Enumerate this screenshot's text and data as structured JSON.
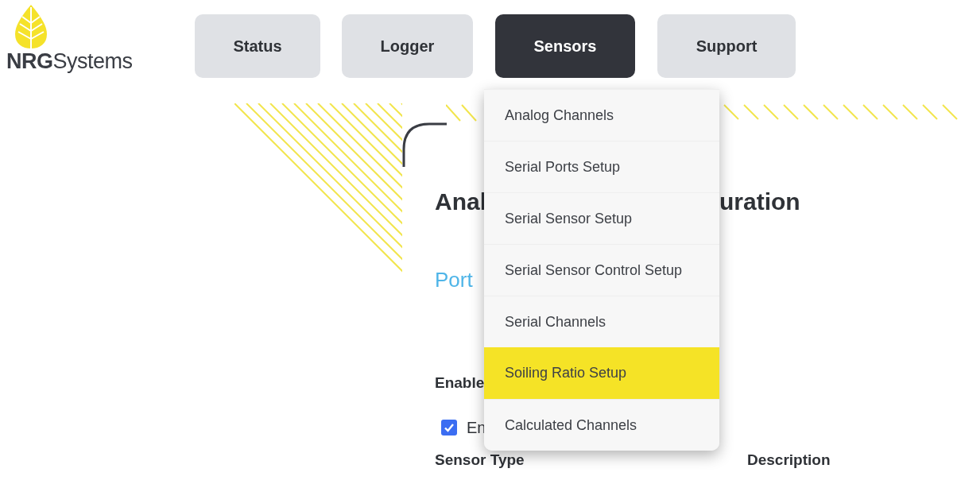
{
  "logo": {
    "text": "**NRG**Systems"
  },
  "nav": [
    {
      "label": "Status",
      "selected": false
    },
    {
      "label": "Logger",
      "selected": false
    },
    {
      "label": "Sensors",
      "selected": true
    },
    {
      "label": "Support",
      "selected": false
    }
  ],
  "menu": [
    {
      "label": "Analog Channels",
      "selected": false
    },
    {
      "label": "Serial Ports Setup",
      "selected": false
    },
    {
      "label": "Serial Sensor Setup",
      "selected": false
    },
    {
      "label": "Serial Sensor Control Setup",
      "selected": false
    },
    {
      "label": "Serial Channels",
      "selected": false
    },
    {
      "label": "Soiling Ratio Setup",
      "selected": true
    },
    {
      "label": "Calculated Channels",
      "selected": false
    }
  ],
  "page": {
    "title_parts": [
      "Anal",
      "uration"
    ],
    "port_link": "Port",
    "section_label": "Enable",
    "enable_checkbox": {
      "label": "En",
      "checked": true
    },
    "columns": [
      "Sensor Type",
      "Description"
    ]
  }
}
